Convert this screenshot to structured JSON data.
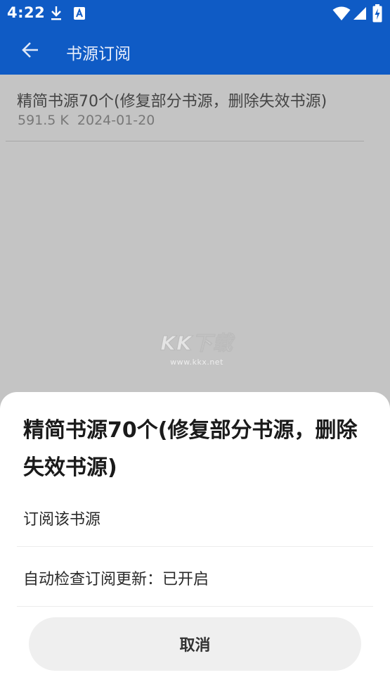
{
  "status_bar": {
    "time": "4:22",
    "icons": [
      "download-icon",
      "translate-a-icon",
      "wifi-icon",
      "signal-icon",
      "battery-icon"
    ]
  },
  "app_bar": {
    "title": "书源订阅",
    "back_icon": "arrow-left-icon"
  },
  "list": {
    "items": [
      {
        "title": "精简书源70个(修复部分书源，删除失效书源)",
        "size": "591.5 K",
        "date": "2024-01-20"
      }
    ]
  },
  "watermark": {
    "brand": "KK下载",
    "url": "www.kkx.net"
  },
  "sheet": {
    "title": "精简书源70个(修复部分书源，删除失效书源)",
    "options": [
      {
        "label": "订阅该书源"
      },
      {
        "label": "自动检查订阅更新：已开启"
      }
    ],
    "cancel_label": "取消"
  },
  "colors": {
    "primary": "#0f5bc5",
    "scrim": "#c4c4c4",
    "sheet": "#ffffff",
    "cancel_bg": "#efefef"
  }
}
